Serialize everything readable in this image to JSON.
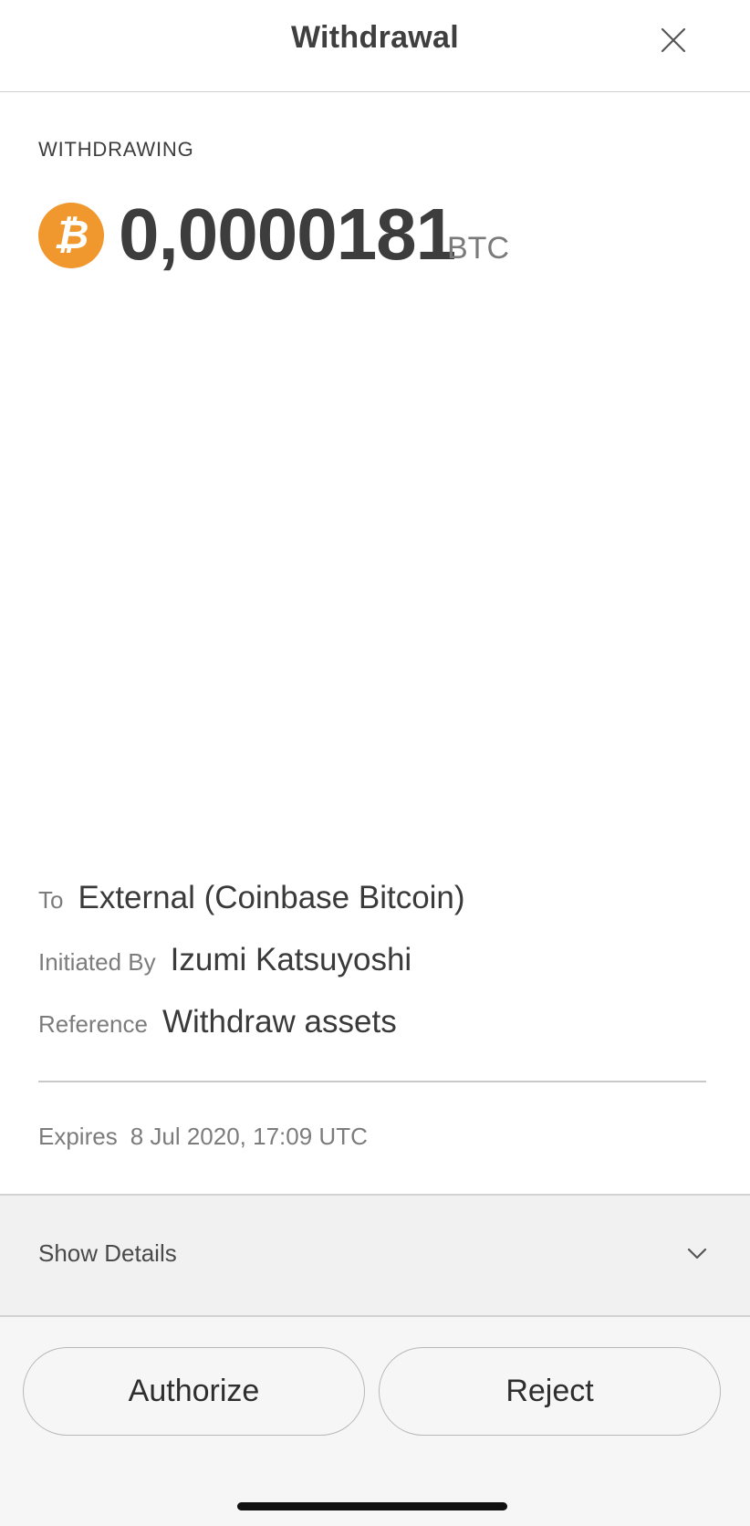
{
  "header": {
    "title": "Withdrawal",
    "close_icon": "close-icon"
  },
  "transaction": {
    "eyebrow": "WITHDRAWING",
    "coin_icon": "bitcoin-icon",
    "coin_glyph": "₿",
    "coin_color": "#f0972e",
    "amount": "0,0000181",
    "unit": "BTC"
  },
  "details": {
    "to": {
      "label": "To",
      "value": "External (Coinbase Bitcoin)"
    },
    "initiated_by": {
      "label": "Initiated By",
      "value": "Izumi Katsuyoshi"
    },
    "reference": {
      "label": "Reference",
      "value": "Withdraw assets"
    }
  },
  "expires": {
    "label": "Expires",
    "value": "8 Jul 2020, 17:09 UTC"
  },
  "show_details": {
    "label": "Show Details",
    "icon": "chevron-down-icon"
  },
  "actions": {
    "authorize_label": "Authorize",
    "reject_label": "Reject"
  }
}
